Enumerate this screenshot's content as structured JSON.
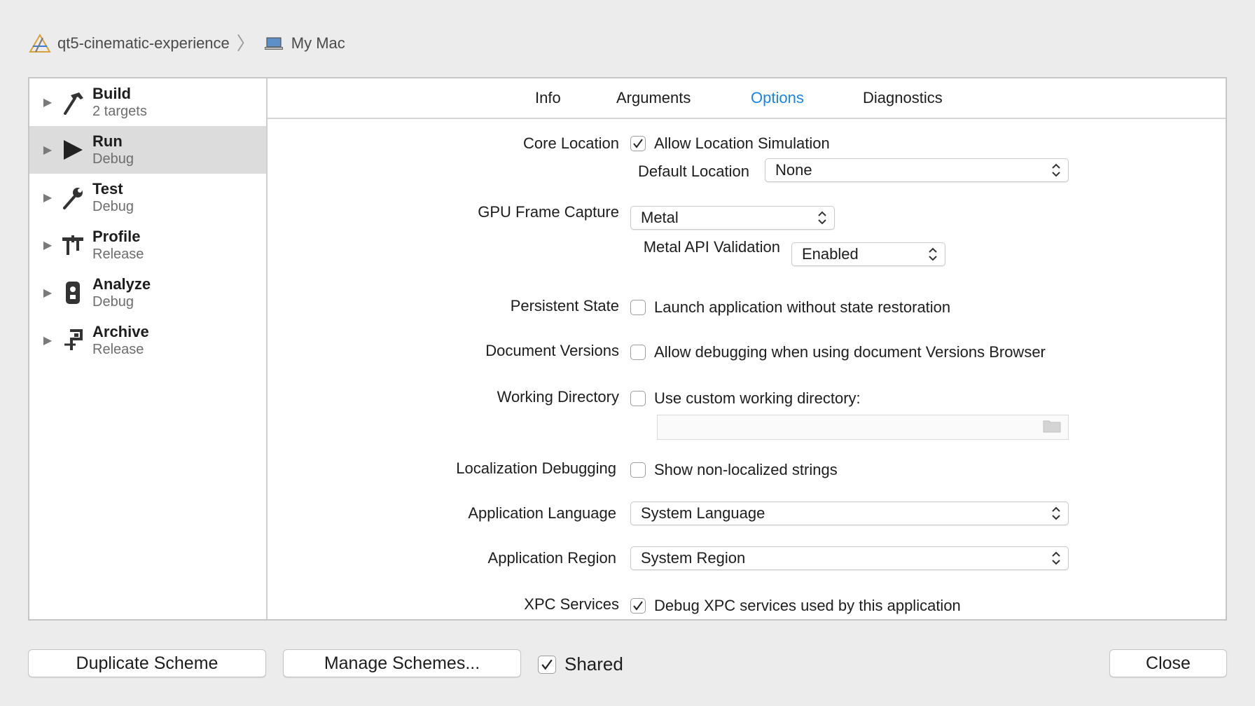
{
  "breadcrumb": {
    "project_icon": "xcode-project-icon",
    "project": "qt5-cinematic-experience",
    "separator": "〉",
    "destination_icon": "laptop-icon",
    "destination": "My Mac"
  },
  "sidebar": {
    "items": [
      {
        "title": "Build",
        "subtitle": "2 targets",
        "icon": "hammer-icon"
      },
      {
        "title": "Run",
        "subtitle": "Debug",
        "icon": "play-icon"
      },
      {
        "title": "Test",
        "subtitle": "Debug",
        "icon": "wrench-icon"
      },
      {
        "title": "Profile",
        "subtitle": "Release",
        "icon": "caliper-icon"
      },
      {
        "title": "Analyze",
        "subtitle": "Debug",
        "icon": "analyze-icon"
      },
      {
        "title": "Archive",
        "subtitle": "Release",
        "icon": "archive-icon"
      }
    ],
    "selected": "Run"
  },
  "tabs": {
    "items": [
      "Info",
      "Arguments",
      "Options",
      "Diagnostics"
    ],
    "active": "Options"
  },
  "options": {
    "core_location": {
      "label": "Core Location",
      "checkbox_label": "Allow Location Simulation",
      "checked": true,
      "default_location_label": "Default Location",
      "default_location_value": "None"
    },
    "gpu_frame_capture": {
      "label": "GPU Frame Capture",
      "value": "Metal",
      "metal_api_label": "Metal API Validation",
      "metal_api_value": "Enabled"
    },
    "persistent_state": {
      "label": "Persistent State",
      "checkbox_label": "Launch application without state restoration",
      "checked": false
    },
    "document_versions": {
      "label": "Document Versions",
      "checkbox_label": "Allow debugging when using document Versions Browser",
      "checked": false
    },
    "working_directory": {
      "label": "Working Directory",
      "checkbox_label": "Use custom working directory:",
      "checked": false,
      "path_value": "",
      "folder_icon": "folder-icon"
    },
    "localization_debugging": {
      "label": "Localization Debugging",
      "checkbox_label": "Show non-localized strings",
      "checked": false
    },
    "application_language": {
      "label": "Application Language",
      "value": "System Language"
    },
    "application_region": {
      "label": "Application Region",
      "value": "System Region"
    },
    "xpc_services": {
      "label": "XPC Services",
      "checkbox_label": "Debug XPC services used by this application",
      "checked": true
    }
  },
  "footer": {
    "duplicate_label": "Duplicate Scheme",
    "manage_label": "Manage Schemes...",
    "shared_label": "Shared",
    "shared_checked": true,
    "close_label": "Close"
  },
  "colors": {
    "accent": "#1a84e8",
    "selected_row": "#dcdcdc",
    "window_bg": "#ececec"
  }
}
